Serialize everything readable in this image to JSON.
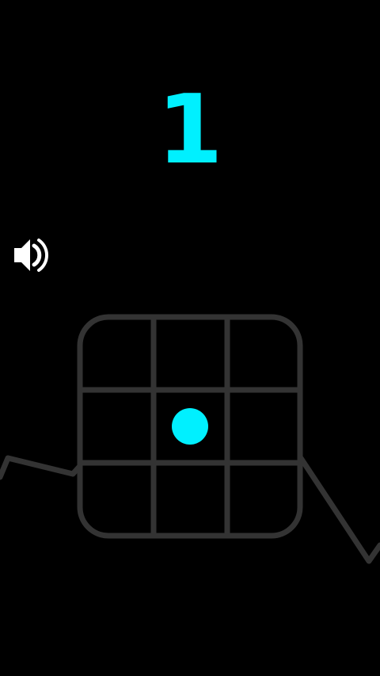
{
  "score": "1",
  "colors": {
    "background": "#000000",
    "accent": "#00f0ff",
    "grid": "#333333",
    "icon": "#ffffff"
  },
  "sound": {
    "icon": "speaker-on-icon",
    "state": "on"
  },
  "board": {
    "rows": 3,
    "cols": 3,
    "ball": {
      "row": 1,
      "col": 1
    }
  }
}
